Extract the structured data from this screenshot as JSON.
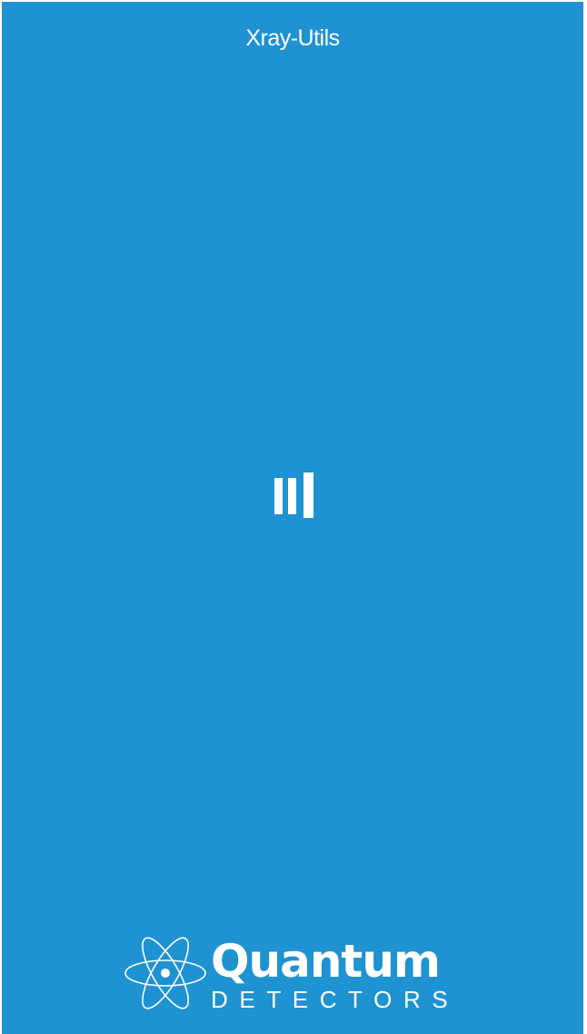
{
  "app": {
    "title": "Xray-Utils"
  },
  "loading_indicator": {
    "icon": "loading-bars-icon"
  },
  "brand_logo": {
    "icon": "atom-icon",
    "name": "Quantum",
    "tagline": "DETECTORS"
  },
  "colors": {
    "background": "#1f92d1",
    "foreground": "#ffffff"
  }
}
